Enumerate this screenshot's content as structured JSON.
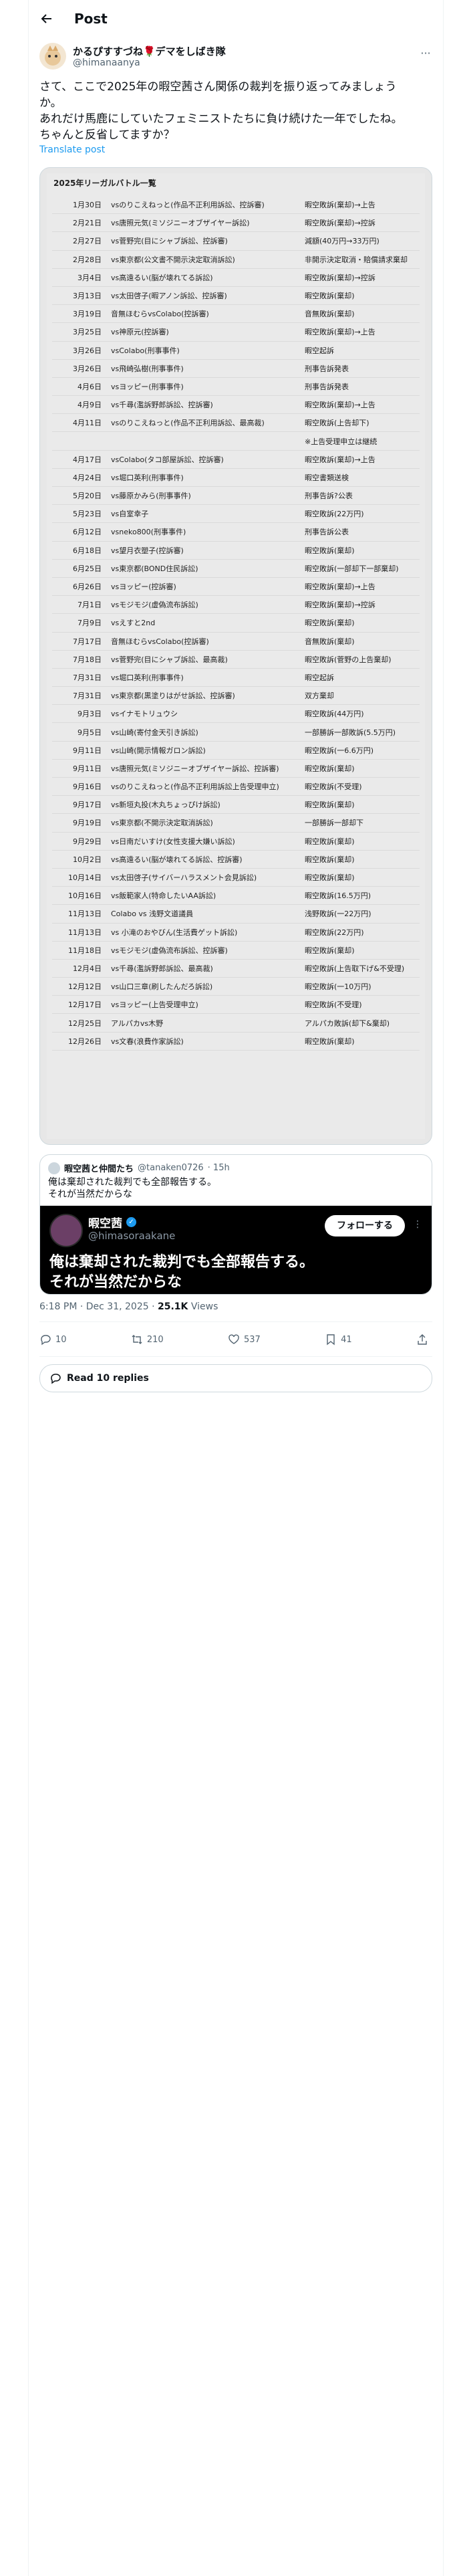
{
  "topbar": {
    "title": "Post"
  },
  "author": {
    "name": "かるぴすすづね🌹デマをしばき隊",
    "handle": "@himanaanya"
  },
  "post": {
    "lines": [
      "さて、ここで2025年の暇空茜さん関係の裁判を振り返ってみましょう",
      "か。",
      "あれだけ馬鹿にしていたフェミニストたちに負け続けた一年でしたね。",
      "ちゃんと反省してますか？"
    ],
    "translate": "Translate post"
  },
  "table": {
    "title": "2025年リーガルバトル一覧",
    "rows": [
      {
        "date": "1月30日",
        "case": "vsのりこえねっと(作品不正利用訴訟、控訴審)",
        "result": "暇空敗訴(棄却)→上告"
      },
      {
        "date": "2月21日",
        "case": "vs唐照元気(ミソジニーオブザイヤー訴訟)",
        "result": "暇空敗訴(棄却)→控訴"
      },
      {
        "date": "2月27日",
        "case": "vs菅野完(目にシャブ訴訟、控訴審)",
        "result": "減額(40万円→33万円)"
      },
      {
        "date": "2月28日",
        "case": "vs東京都(公文書不開示決定取消訴訟)",
        "result": "非開示決定取消・賠償請求棄却"
      },
      {
        "date": "3月4日",
        "case": "vs高遠るい(脳が壊れてる訴訟)",
        "result": "暇空敗訴(棄却)→控訴"
      },
      {
        "date": "3月13日",
        "case": "vs太田啓子(暇アノン訴訟、控訴審)",
        "result": "暇空敗訴(棄却)"
      },
      {
        "date": "3月19日",
        "case": "音無ほむらvsColabo(控訴審)",
        "result": "音無敗訴(棄却)"
      },
      {
        "date": "3月25日",
        "case": "vs神原元(控訴審)",
        "result": "暇空敗訴(棄却)→上告"
      },
      {
        "date": "3月26日",
        "case": "vsColabo(刑事事件)",
        "result": "暇空起訴"
      },
      {
        "date": "3月26日",
        "case": "vs飛崎弘樹(刑事事件)",
        "result": "刑事告訴発表"
      },
      {
        "date": "4月6日",
        "case": "vsヨッピー(刑事事件)",
        "result": "刑事告訴発表"
      },
      {
        "date": "4月9日",
        "case": "vs千尋(濫訴野郎訴訟、控訴審)",
        "result": "暇空敗訴(棄却)→上告"
      },
      {
        "date": "4月11日",
        "case": "vsのりこえねっと(作品不正利用訴訟、最高裁)",
        "result": "暇空敗訴(上告却下)"
      },
      {
        "date": "",
        "case": "",
        "result": "※上告受理申立は継続"
      },
      {
        "date": "4月17日",
        "case": "vsColabo(タコ部屋訴訟、控訴審)",
        "result": "暇空敗訴(棄却)→上告"
      },
      {
        "date": "4月24日",
        "case": "vs堀口英利(刑事事件)",
        "result": "暇空書類送検"
      },
      {
        "date": "5月20日",
        "case": "vs藤原かみら(刑事事件)",
        "result": "刑事告訴?公表"
      },
      {
        "date": "5月23日",
        "case": "vs自室幸子",
        "result": "暇空敗訴(22万円)"
      },
      {
        "date": "6月12日",
        "case": "vsneko800(刑事事件)",
        "result": "刑事告訴公表"
      },
      {
        "date": "6月18日",
        "case": "vs望月衣塑子(控訴審)",
        "result": "暇空敗訴(棄却)"
      },
      {
        "date": "6月25日",
        "case": "vs東京都(BOND住民訴訟)",
        "result": "暇空敗訴(一部却下一部棄却)"
      },
      {
        "date": "6月26日",
        "case": "vsヨッピー(控訴審)",
        "result": "暇空敗訴(棄却)→上告"
      },
      {
        "date": "7月1日",
        "case": "vsモジモジ(虚偽流布訴訟)",
        "result": "暇空敗訴(棄却)→控訴"
      },
      {
        "date": "7月9日",
        "case": "vsえすと2nd",
        "result": "暇空敗訴(棄却)"
      },
      {
        "date": "7月17日",
        "case": "音無ほむらvsColabo(控訴審)",
        "result": "音無敗訴(棄却)"
      },
      {
        "date": "7月18日",
        "case": "vs菅野完(目にシャブ訴訟、最高裁)",
        "result": "暇空敗訴(菅野の上告棄却)"
      },
      {
        "date": "7月31日",
        "case": "vs堀口英利(刑事事件)",
        "result": "暇空起訴"
      },
      {
        "date": "7月31日",
        "case": "vs東京都(黒塗りはがせ訴訟、控訴審)",
        "result": "双方棄却"
      },
      {
        "date": "9月3日",
        "case": "vsイナモトリュウシ",
        "result": "暇空敗訴(44万円)"
      },
      {
        "date": "9月5日",
        "case": "vs山崎(寄付金天引き訴訟)",
        "result": "一部勝訴一部敗訴(5.5万円)"
      },
      {
        "date": "9月11日",
        "case": "vs山崎(開示情報ガロン訴訟)",
        "result": "暇空敗訴(一6.6万円)"
      },
      {
        "date": "9月11日",
        "case": "vs唐照元気(ミソジニーオブザイヤー訴訟、控訴審)",
        "result": "暇空敗訴(棄却)"
      },
      {
        "date": "9月16日",
        "case": "vsのりこえねっと(作品不正利用訴訟上告受理申立)",
        "result": "暇空敗訴(不受理)"
      },
      {
        "date": "9月17日",
        "case": "vs新垣丸投(木丸ちょっぴけ訴訟)",
        "result": "暇空敗訴(棄却)"
      },
      {
        "date": "9月19日",
        "case": "vs東京都(不開示決定取消訴訟)",
        "result": "一部勝訴一部却下"
      },
      {
        "date": "9月29日",
        "case": "vs日南だいすけ(女性支援大嫌い訴訟)",
        "result": "暇空敗訴(棄却)"
      },
      {
        "date": "10月2日",
        "case": "vs高遠るい(脳が壊れてる訴訟、控訴審)",
        "result": "暇空敗訴(棄却)"
      },
      {
        "date": "10月14日",
        "case": "vs太田啓子(サイバーハラスメント会見訴訟)",
        "result": "暇空敗訴(棄却)"
      },
      {
        "date": "10月16日",
        "case": "vs飯範家人(特命したいAA訴訟)",
        "result": "暇空敗訴(16.5万円)"
      },
      {
        "date": "11月13日",
        "case": "Colabo vs 浅野文道議員",
        "result": "浅野敗訴(一22万円)"
      },
      {
        "date": "11月13日",
        "case": "vs 小滝のおやびん(生活費ゲット訴訟)",
        "result": "暇空敗訴(22万円)"
      },
      {
        "date": "11月18日",
        "case": "vsモジモジ(虚偽流布訴訟、控訴審)",
        "result": "暇空敗訴(棄却)"
      },
      {
        "date": "12月4日",
        "case": "vs千尋(濫訴野郎訴訟、最高裁)",
        "result": "暇空敗訴(上告取下げ&不受理)"
      },
      {
        "date": "12月12日",
        "case": "vs山口三章(刷したんだろ訴訟)",
        "result": "暇空敗訴(一10万円)"
      },
      {
        "date": "12月17日",
        "case": "vsヨッピー(上告受理申立)",
        "result": "暇空敗訴(不受理)"
      },
      {
        "date": "12月25日",
        "case": "アルパカvs木野",
        "result": "アルパカ敗訴(却下&棄却)"
      },
      {
        "date": "12月26日",
        "case": "vs文春(浪費作家訴訟)",
        "result": "暇空敗訴(棄却)"
      }
    ]
  },
  "quote": {
    "name": "暇空茜と仲間たち",
    "handle": "@tanaken0726",
    "time": "· 15h",
    "lines": [
      "俺は棄却された裁判でも全部報告する。",
      "それが当然だからな"
    ],
    "image": {
      "name": "暇空茜",
      "handle": "@himasoraakane",
      "follow": "フォローする",
      "lines": [
        "俺は棄却された裁判でも全部報告する。",
        "それが当然だからな"
      ]
    }
  },
  "meta": {
    "time": "6:18 PM · Dec 31, 2025 · ",
    "views_count": "25.1K",
    "views_label": " Views"
  },
  "actions": {
    "replies": "10",
    "reposts": "210",
    "likes": "537",
    "bookmarks": "41"
  },
  "read_replies": "Read 10 replies"
}
